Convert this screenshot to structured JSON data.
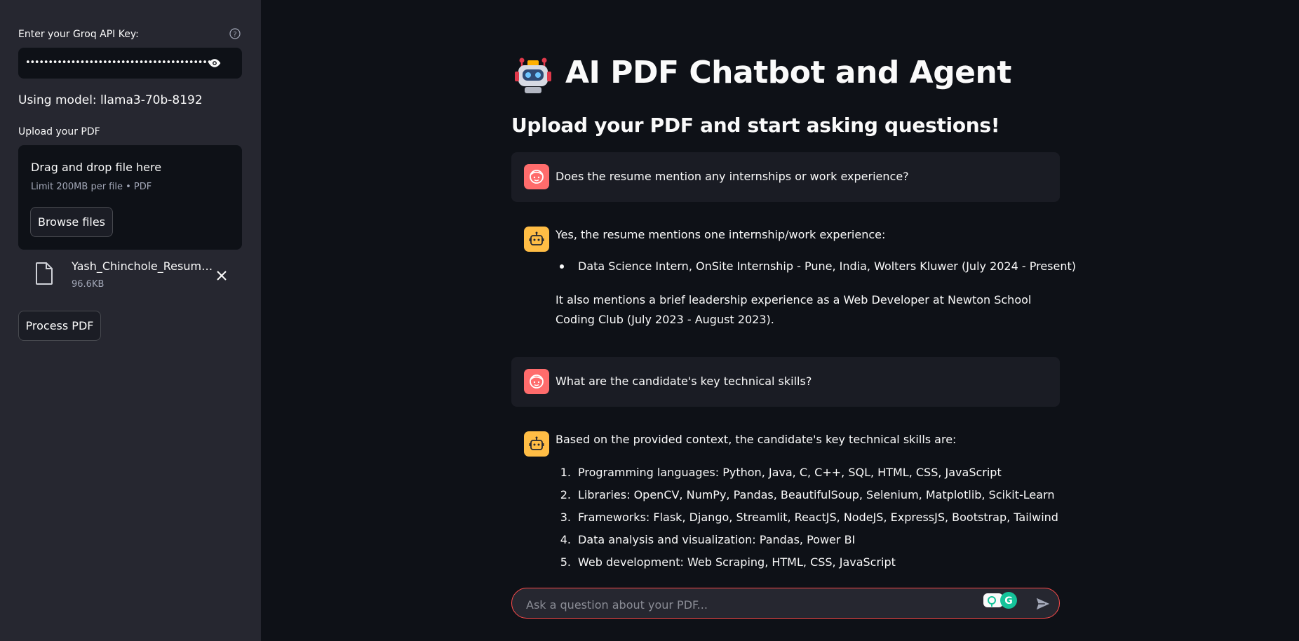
{
  "sidebar": {
    "api_key_label": "Enter your Groq API Key:",
    "api_key_value": "•••••••••••••••••••••••••••••••••••••••••••••••••••",
    "model_text": "Using model: llama3-70b-8192",
    "upload_label": "Upload your PDF",
    "dropzone_title": "Drag and drop file here",
    "dropzone_limit": "Limit 200MB per file • PDF",
    "browse_label": "Browse files",
    "file": {
      "name": "Yash_Chinchole_Resume.pdf",
      "size": "96.6KB"
    },
    "process_label": "Process PDF"
  },
  "main": {
    "title": "AI PDF Chatbot and Agent",
    "subtitle": "Upload your PDF and start asking questions!",
    "messages": [
      {
        "role": "user",
        "text": "Does the resume mention any internships or work experience?"
      },
      {
        "role": "assistant",
        "intro": "Yes, the resume mentions one internship/work experience:",
        "bullets": [
          "Data Science Intern, OnSite Internship - Pune, India, Wolters Kluwer (July 2024 - Present)"
        ],
        "outro": "It also mentions a brief leadership experience as a Web Developer at Newton School Coding Club (July 2023 - August 2023)."
      },
      {
        "role": "user",
        "text": "What are the candidate's key technical skills?"
      },
      {
        "role": "assistant",
        "intro": "Based on the provided context, the candidate's key technical skills are:",
        "items": [
          {
            "num": "1.",
            "text": "Programming languages: Python, Java, C, C++, SQL, HTML, CSS, JavaScript"
          },
          {
            "num": "2.",
            "text": "Libraries: OpenCV, NumPy, Pandas, BeautifulSoup, Selenium, Matplotlib, Scikit-Learn"
          },
          {
            "num": "3.",
            "text": "Frameworks: Flask, Django, Streamlit, ReactJS, NodeJS, ExpressJS, Bootstrap, Tailwind"
          },
          {
            "num": "4.",
            "text": "Data analysis and visualization: Pandas, Power BI"
          },
          {
            "num": "5.",
            "text": "Web development: Web Scraping, HTML, CSS, JavaScript"
          }
        ]
      }
    ],
    "chat_placeholder": "Ask a question about your PDF..."
  },
  "colors": {
    "sidebar_bg": "#262730",
    "app_bg": "#0e1117",
    "user_avatar": "#ff6c6c",
    "assistant_avatar": "#ffbd45",
    "input_border": "#ff4b4b"
  },
  "icons": [
    "help-icon",
    "eye-icon",
    "file-icon",
    "close-icon",
    "robot-logo",
    "user-face-icon",
    "bot-icon",
    "grammarly-icon",
    "send-icon"
  ]
}
